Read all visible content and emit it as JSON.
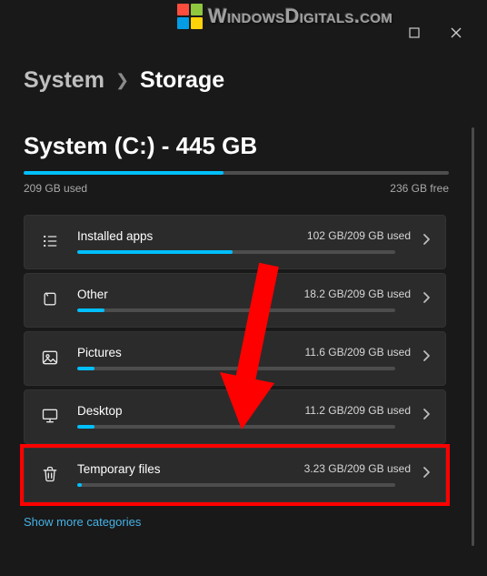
{
  "watermark": {
    "text": "WindowsDigitals.com"
  },
  "breadcrumb": {
    "prev": "System",
    "curr": "Storage"
  },
  "drive": {
    "title": "System (C:) - 445 GB",
    "used_label": "209 GB used",
    "free_label": "236 GB free",
    "used_gb": 209,
    "total_gb": 445
  },
  "categories": [
    {
      "name": "Installed apps",
      "used_label": "102 GB/209 GB used",
      "used_gb": 102,
      "total_gb": 209,
      "icon": "list",
      "highlight": false
    },
    {
      "name": "Other",
      "used_label": "18.2 GB/209 GB used",
      "used_gb": 18.2,
      "total_gb": 209,
      "icon": "folder",
      "highlight": false
    },
    {
      "name": "Pictures",
      "used_label": "11.6 GB/209 GB used",
      "used_gb": 11.6,
      "total_gb": 209,
      "icon": "picture",
      "highlight": false
    },
    {
      "name": "Desktop",
      "used_label": "11.2 GB/209 GB used",
      "used_gb": 11.2,
      "total_gb": 209,
      "icon": "monitor",
      "highlight": false
    },
    {
      "name": "Temporary files",
      "used_label": "3.23 GB/209 GB used",
      "used_gb": 3.23,
      "total_gb": 209,
      "icon": "trash",
      "highlight": true
    }
  ],
  "show_more": "Show more categories"
}
